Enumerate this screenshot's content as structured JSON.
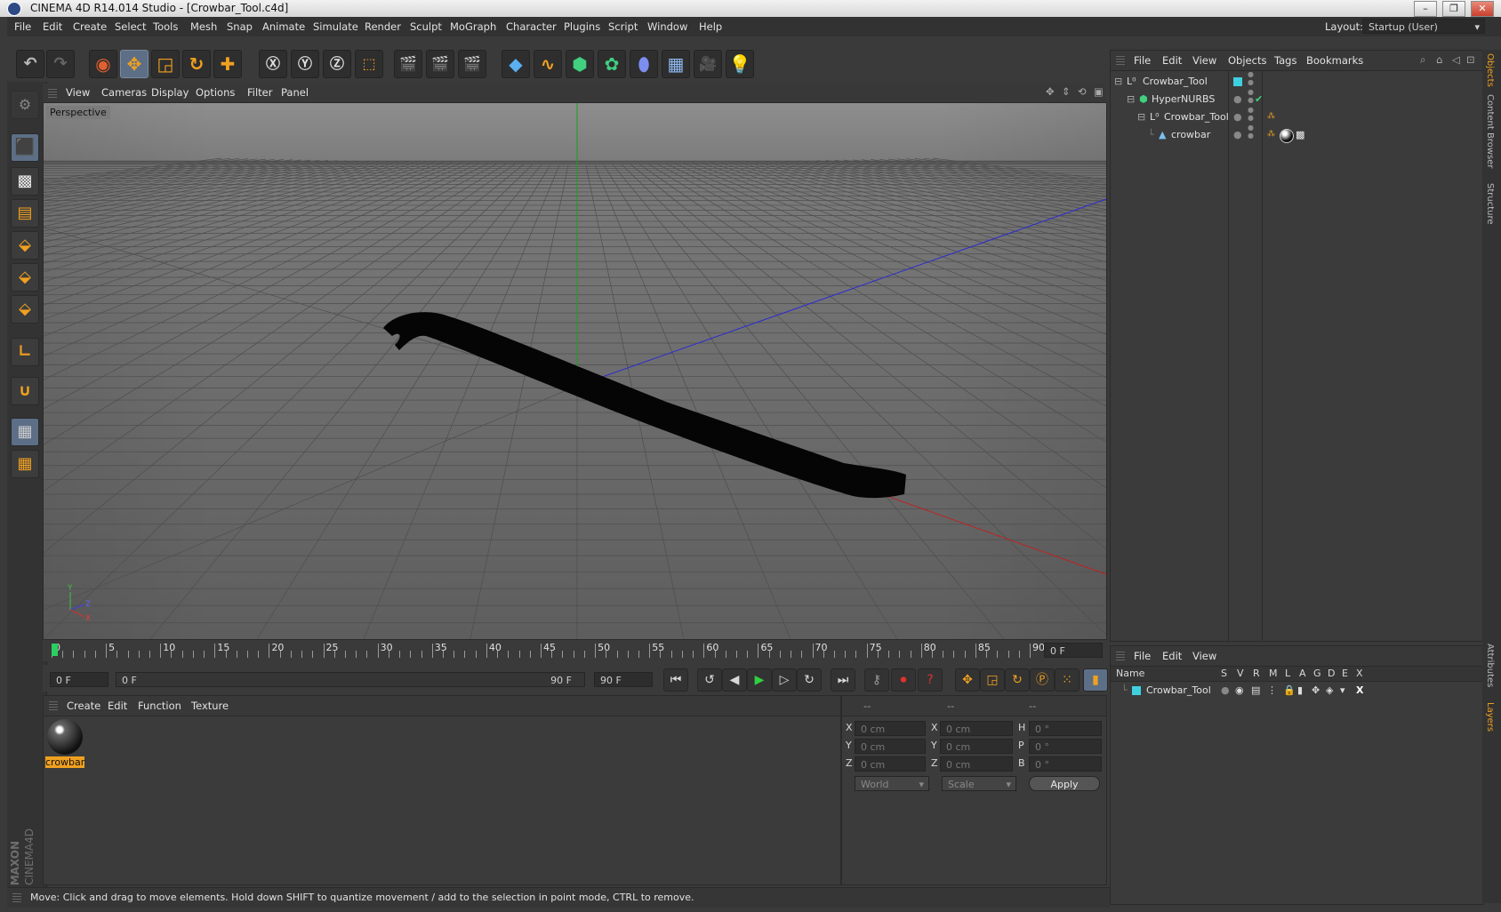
{
  "window": {
    "title": "CINEMA 4D R14.014 Studio - [Crowbar_Tool.c4d]"
  },
  "menu": [
    "File",
    "Edit",
    "Create",
    "Select",
    "Tools",
    "Mesh",
    "Snap",
    "Animate",
    "Simulate",
    "Render",
    "Sculpt",
    "MoGraph",
    "Character",
    "Plugins",
    "Script",
    "Window",
    "Help"
  ],
  "layout": {
    "label": "Layout:",
    "value": "Startup (User)"
  },
  "viewport": {
    "menu": [
      "View",
      "Cameras",
      "Display",
      "Options",
      "Filter",
      "Panel"
    ],
    "label": "Perspective",
    "axis": {
      "y": "Y",
      "z": "Z",
      "x": "X"
    }
  },
  "timeline": {
    "ticks": [
      "0",
      "5",
      "10",
      "15",
      "20",
      "25",
      "30",
      "35",
      "40",
      "45",
      "50",
      "55",
      "60",
      "65",
      "70",
      "75",
      "80",
      "85",
      "90"
    ],
    "current_frame": "0 F",
    "start_field": "0 F",
    "range_start": "0 F",
    "range_end": "90 F",
    "end_field": "90 F"
  },
  "materials": {
    "menu": [
      "Create",
      "Edit",
      "Function",
      "Texture"
    ],
    "items": [
      {
        "name": "crowbar"
      }
    ]
  },
  "coords": {
    "headers": [
      "--",
      "--",
      "--"
    ],
    "rows": [
      {
        "a": "X",
        "av": "0 cm",
        "b": "X",
        "bv": "0 cm",
        "c": "H",
        "cv": "0 °"
      },
      {
        "a": "Y",
        "av": "0 cm",
        "b": "Y",
        "bv": "0 cm",
        "c": "P",
        "cv": "0 °"
      },
      {
        "a": "Z",
        "av": "0 cm",
        "b": "Z",
        "bv": "0 cm",
        "c": "B",
        "cv": "0 °"
      }
    ],
    "space": "World",
    "mode": "Scale",
    "apply": "Apply"
  },
  "objects": {
    "menu": [
      "File",
      "Edit",
      "View",
      "Objects",
      "Tags",
      "Bookmarks"
    ],
    "tree": [
      {
        "name": "Crowbar_Tool",
        "depth": 0
      },
      {
        "name": "HyperNURBS",
        "depth": 1
      },
      {
        "name": "Crowbar_Tool",
        "depth": 2
      },
      {
        "name": "crowbar",
        "depth": 3
      }
    ]
  },
  "layers": {
    "menu": [
      "File",
      "Edit",
      "View"
    ],
    "columns": [
      "Name",
      "S",
      "V",
      "R",
      "M",
      "L",
      "A",
      "G",
      "D",
      "E",
      "X"
    ],
    "rows": [
      {
        "name": "Crowbar_Tool"
      }
    ]
  },
  "side_tabs": [
    "Objects",
    "Content Browser",
    "Structure",
    "Attributes",
    "Layers"
  ],
  "brand": {
    "maxon": "MAXON",
    "product": "CINEMA4D"
  },
  "status": "Move: Click and drag to move elements. Hold down SHIFT to quantize movement / add to the selection in point mode, CTRL to remove.",
  "colors": {
    "accent_orange": "#f0a020",
    "selection_blue": "#5d6f86",
    "layer_cyan": "#3fd0e0"
  }
}
